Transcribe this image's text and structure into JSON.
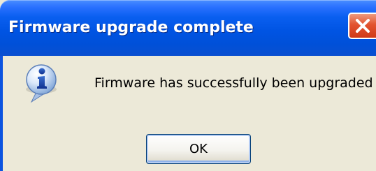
{
  "dialog": {
    "title": "Firmware upgrade complete",
    "message": "Firmware has successfully been upgraded",
    "ok_label": "OK",
    "icon": "info-icon",
    "close_icon": "close-icon"
  },
  "colors": {
    "titlebar": "#0054e3",
    "dialog_background": "#ece9d8",
    "close_button": "#e2532f",
    "button_border": "#003c74"
  }
}
